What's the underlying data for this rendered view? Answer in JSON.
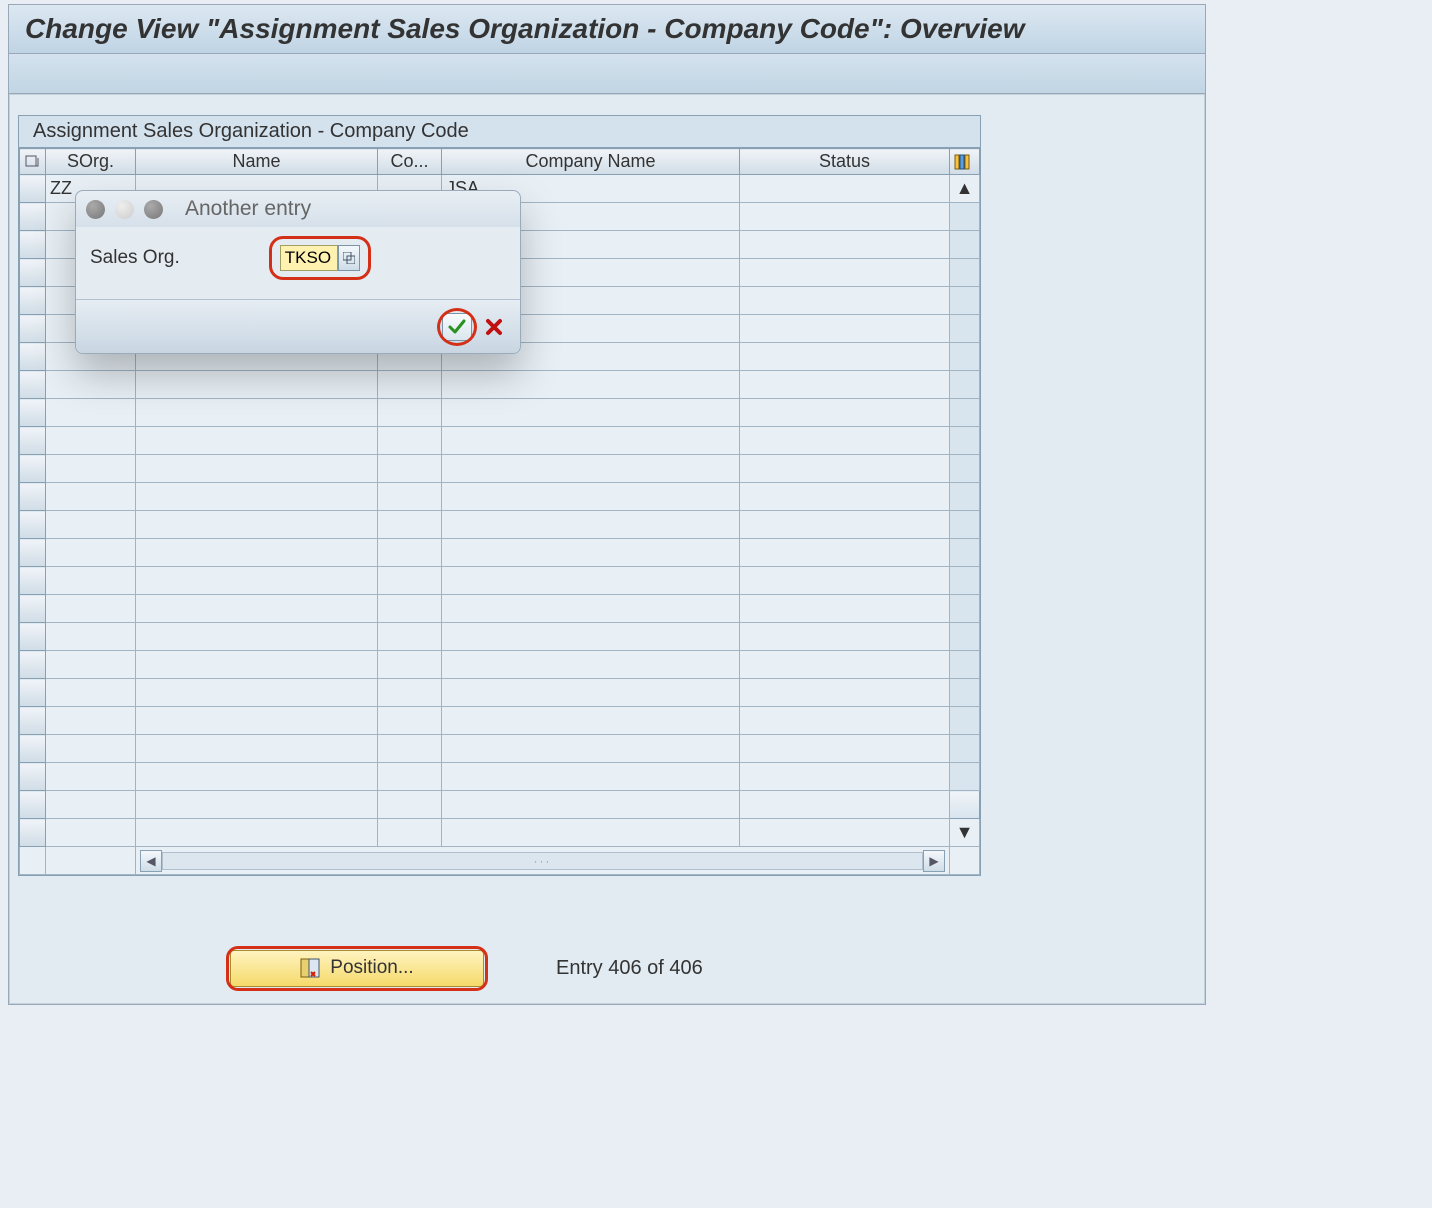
{
  "header": {
    "title": "Change View \"Assignment Sales Organization - Company Code\": Overview"
  },
  "section": {
    "title": "Assignment Sales Organization - Company Code"
  },
  "columns": {
    "sorg": "SOrg.",
    "name": "Name",
    "co": "Co...",
    "company_name": "Company Name",
    "status": "Status"
  },
  "rows": [
    {
      "sorg": "ZZ",
      "name": "",
      "co": "",
      "company_name": "JSA",
      "status": ""
    }
  ],
  "dialog": {
    "title": "Another entry",
    "field_label": "Sales Org.",
    "field_value": "TKSO"
  },
  "footer": {
    "position_label": "Position...",
    "entry_text": "Entry 406 of 406"
  }
}
